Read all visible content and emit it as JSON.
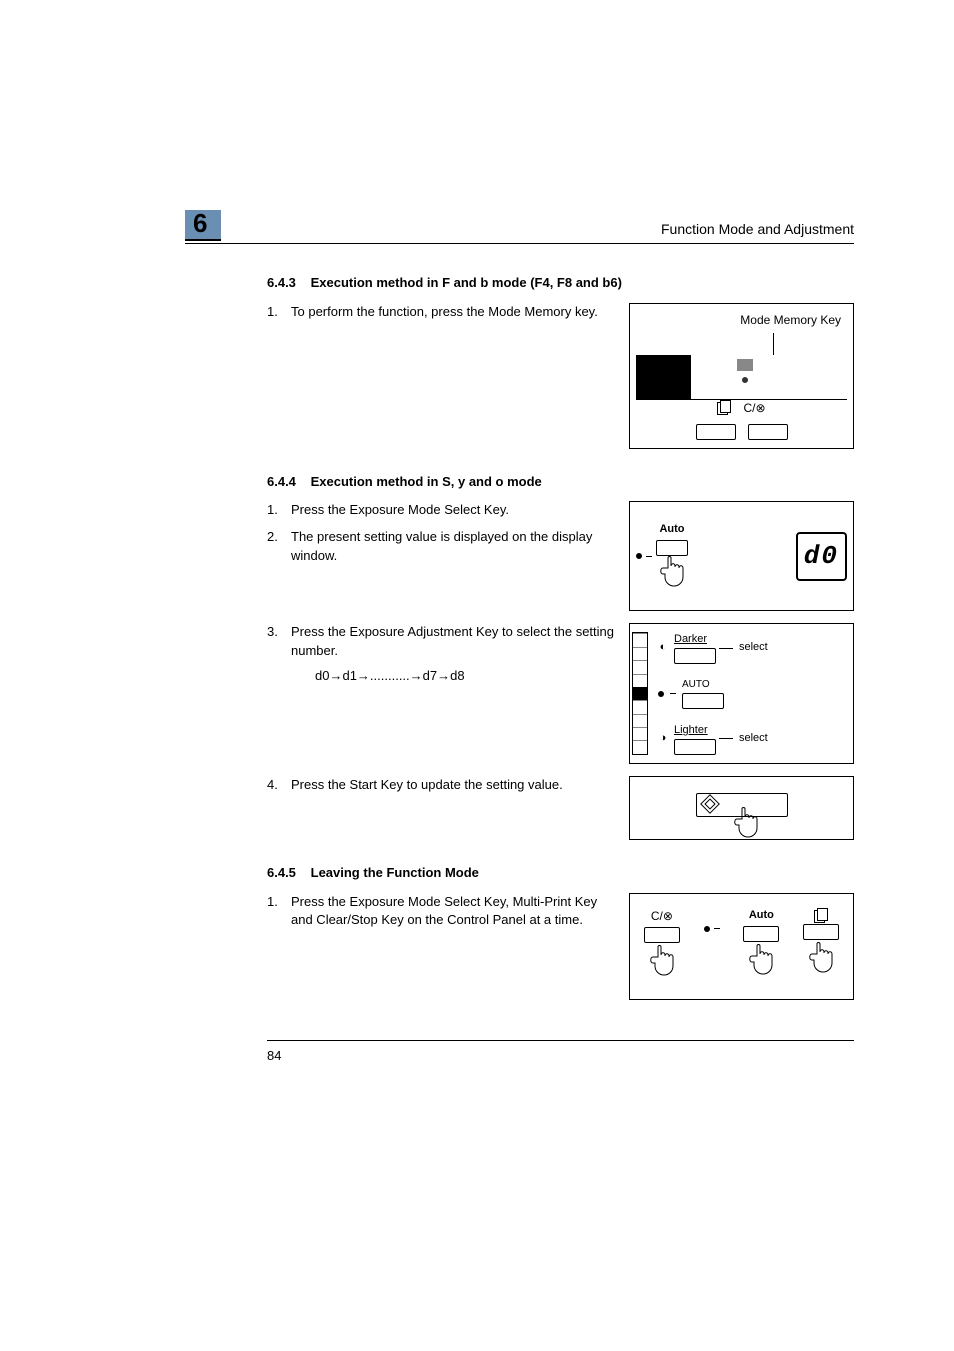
{
  "header": {
    "chapter_number": "6",
    "running_title": "Function Mode and Adjustment"
  },
  "section_643": {
    "number": "6.4.3",
    "title": "Execution method in F and b mode (F4, F8 and b6)",
    "steps": {
      "s1_num": "1.",
      "s1_text": "To perform the function, press the Mode Memory key."
    },
    "figure": {
      "callout": "Mode Memory Key",
      "btn_copies_icon": "copies-icon",
      "btn_clear_label": "C/⊗"
    }
  },
  "section_644": {
    "number": "6.4.4",
    "title": "Execution method in S, y and o mode",
    "steps": {
      "s1_num": "1.",
      "s1_text": "Press the Exposure Mode Select Key.",
      "s2_num": "2.",
      "s2_text": "The present setting value is displayed on the display window.",
      "s3_num": "3.",
      "s3_text": "Press the Exposure Adjustment Key to select the setting number.",
      "s3_seq": "d0→d1→...........→d7→d8",
      "s4_num": "4.",
      "s4_text": "Press the Start Key to update the setting value."
    },
    "figure_auto": {
      "auto_label": "Auto",
      "display_value": "d0"
    },
    "figure_adjust": {
      "darker_label": "Darker",
      "auto_label": "AUTO",
      "lighter_label": "Lighter",
      "select_label_1": "select",
      "select_label_2": "select"
    }
  },
  "section_645": {
    "number": "6.4.5",
    "title": "Leaving the Function Mode",
    "steps": {
      "s1_num": "1.",
      "s1_text": "Press the Exposure Mode Select Key, Multi-Print Key and Clear/Stop Key on the Control Panel at a time."
    },
    "figure": {
      "clear_label": "C/⊗",
      "auto_label": "Auto",
      "copies_icon": "copies-icon"
    }
  },
  "page_number": "84"
}
